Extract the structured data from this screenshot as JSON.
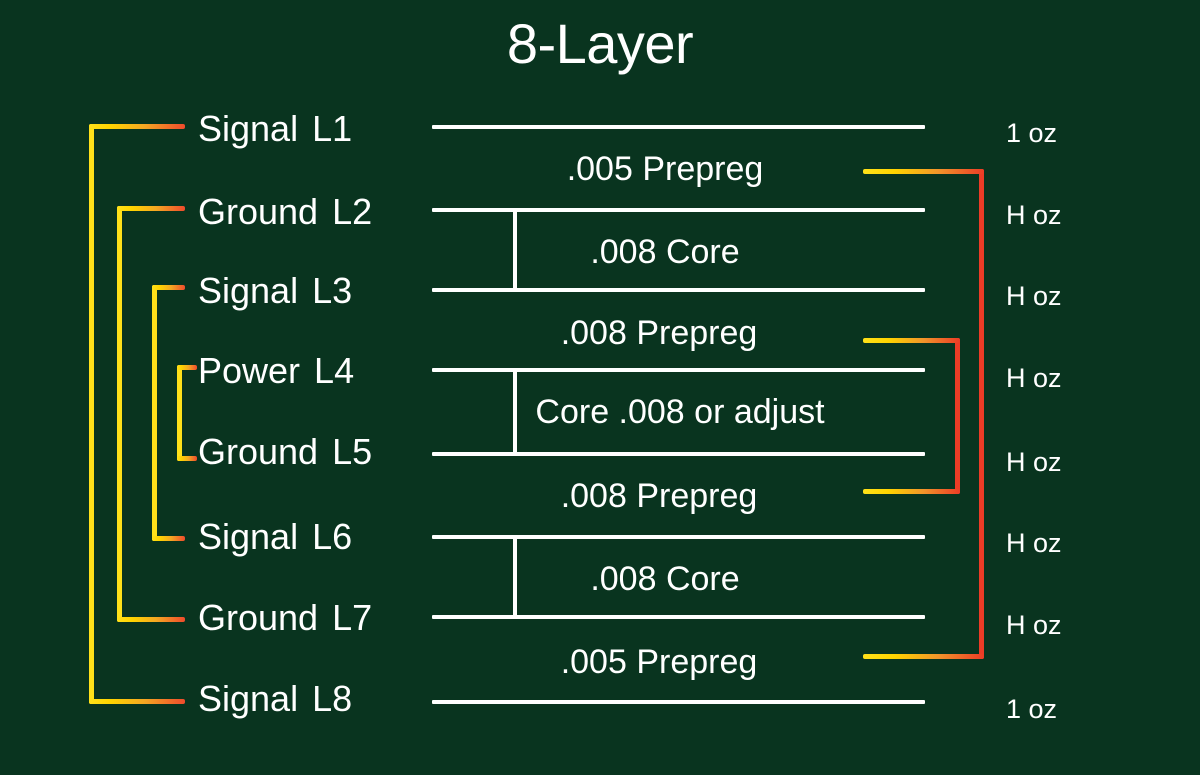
{
  "diagram": {
    "title": "8-Layer",
    "background_color": "#09341f",
    "line_color": "#ffffff",
    "bracket_color_start": "#ffe11a",
    "bracket_color_end": "#ec3c26"
  },
  "layers": [
    {
      "index": 1,
      "name": "Signal",
      "designator": "L1",
      "weight": "1 oz"
    },
    {
      "index": 2,
      "name": "Ground",
      "designator": "L2",
      "weight": "H oz"
    },
    {
      "index": 3,
      "name": "Signal",
      "designator": "L3",
      "weight": "H oz"
    },
    {
      "index": 4,
      "name": "Power",
      "designator": "L4",
      "weight": "H oz"
    },
    {
      "index": 5,
      "name": "Ground",
      "designator": "L5",
      "weight": "H oz"
    },
    {
      "index": 6,
      "name": "Signal",
      "designator": "L6",
      "weight": "H oz"
    },
    {
      "index": 7,
      "name": "Ground",
      "designator": "L7",
      "weight": "H oz"
    },
    {
      "index": 8,
      "name": "Signal",
      "designator": "L8",
      "weight": "1 oz"
    }
  ],
  "dielectrics": [
    {
      "between": "L1-L2",
      "label": ".005 Prepreg",
      "type": "prepreg",
      "thickness": ".005"
    },
    {
      "between": "L2-L3",
      "label": ".008  Core",
      "type": "core",
      "thickness": ".008"
    },
    {
      "between": "L3-L4",
      "label": ".008  Prepreg",
      "type": "prepreg",
      "thickness": ".008"
    },
    {
      "between": "L4-L5",
      "label": "Core .008 or adjust",
      "type": "core",
      "thickness": ".008"
    },
    {
      "between": "L5-L6",
      "label": ".008  Prepreg",
      "type": "prepreg",
      "thickness": ".008"
    },
    {
      "between": "L6-L7",
      "label": ".008  Core",
      "type": "core",
      "thickness": ".008"
    },
    {
      "between": "L7-L8",
      "label": ".005 Prepreg",
      "type": "prepreg",
      "thickness": ".005"
    }
  ],
  "symmetry_brackets": {
    "left": [
      {
        "pairs": "L1-L8",
        "depth": 1
      },
      {
        "pairs": "L2-L7",
        "depth": 2
      },
      {
        "pairs": "L3-L6",
        "depth": 3
      },
      {
        "pairs": "L4-L5",
        "depth": 4
      }
    ],
    "right": [
      {
        "pairs": ".005 Prepreg - .005 Prepreg",
        "depth": 1
      },
      {
        "pairs": ".008 Prepreg - .008 Prepreg",
        "depth": 2
      }
    ]
  }
}
